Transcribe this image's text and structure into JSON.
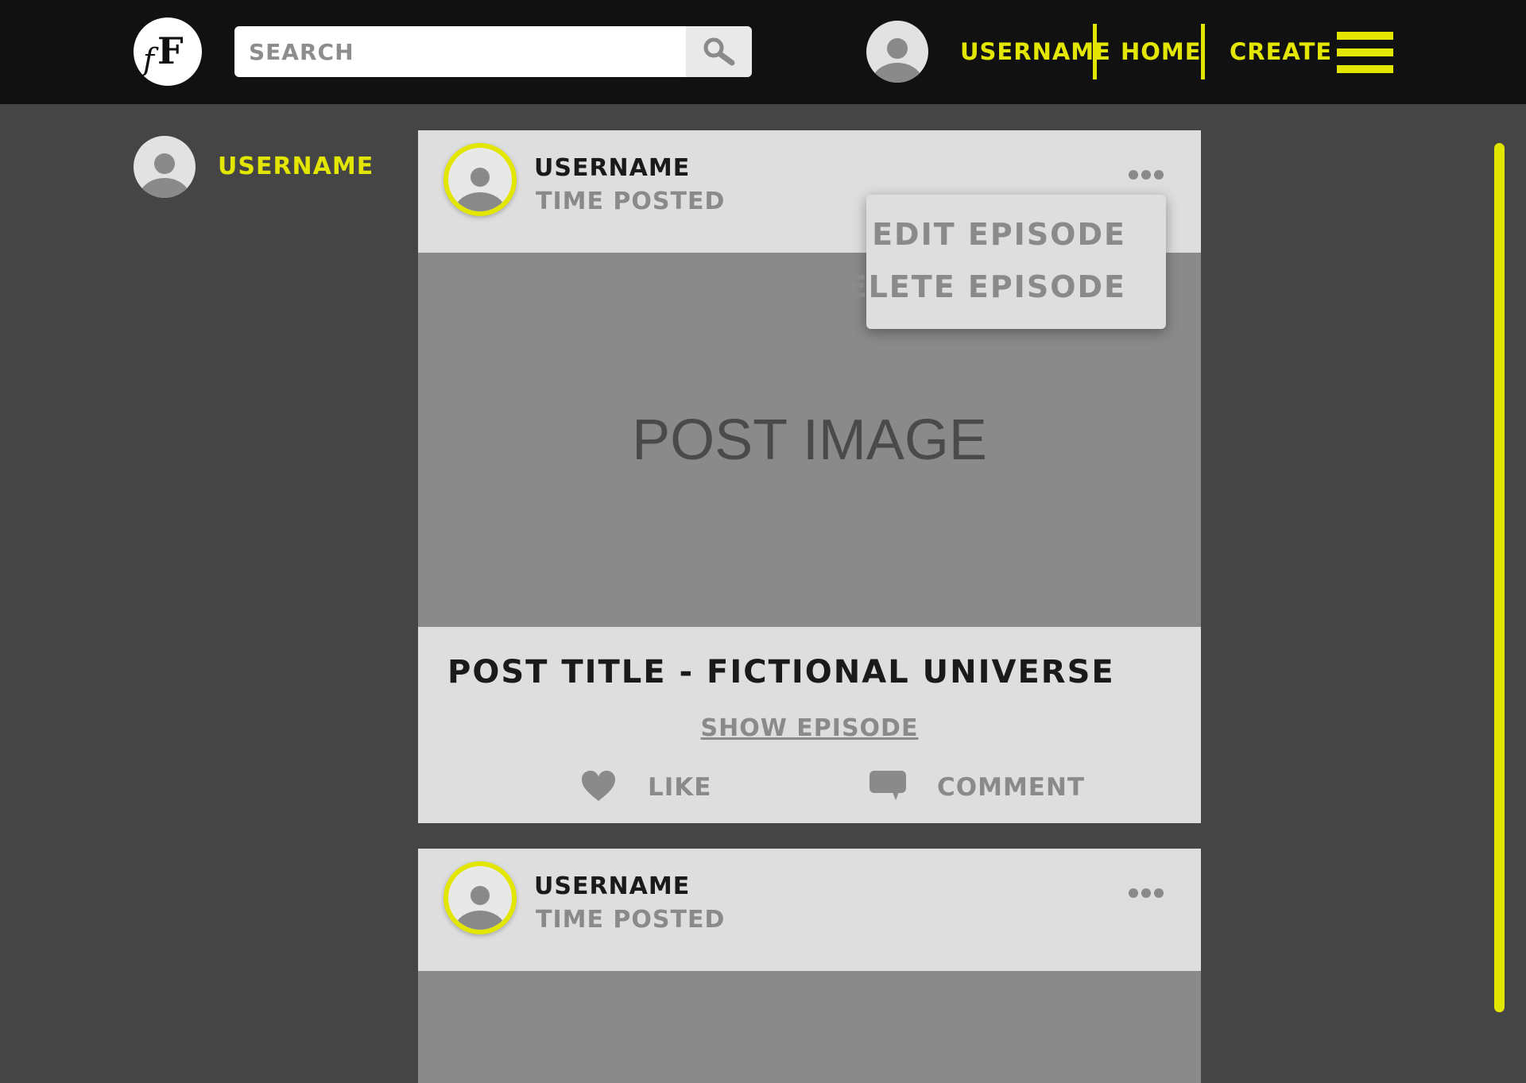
{
  "header": {
    "logo_text": "fF",
    "search": {
      "placeholder": "SEARCH",
      "value": ""
    },
    "nav": {
      "username": "USERNAME",
      "home": "HOME",
      "create": "CREATE"
    }
  },
  "sidebar": {
    "username": "USERNAME"
  },
  "posts": [
    {
      "username": "USERNAME",
      "time": "TIME POSTED",
      "image_label": "POST IMAGE",
      "title": "POST TITLE - FICTIONAL UNIVERSE",
      "show_episode": "SHOW EPISODE",
      "like_label": "LIKE",
      "comment_label": "COMMENT"
    },
    {
      "username": "USERNAME",
      "time": "TIME POSTED"
    }
  ],
  "dropdown": {
    "edit": "EDIT EPISODE",
    "delete": "DELETE EPISODE"
  },
  "icons": [
    "search-icon",
    "user-avatar-icon",
    "menu-icon",
    "more-icon",
    "heart-icon",
    "comment-icon"
  ],
  "colors": {
    "accent": "#e2e600",
    "topbar": "#111111",
    "background": "#454545",
    "card": "#dedede",
    "image": "#8a8a8a",
    "muted": "#8a8a8a"
  }
}
